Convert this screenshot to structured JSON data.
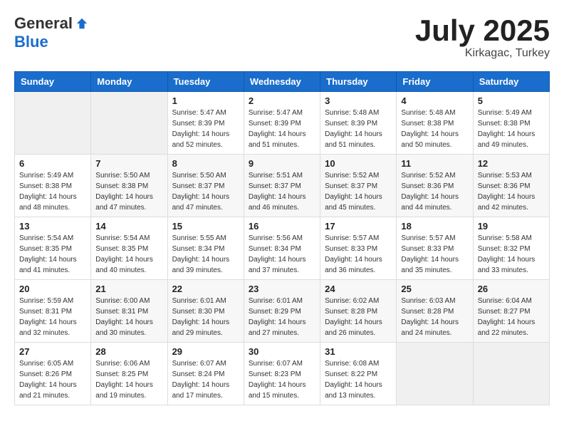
{
  "logo": {
    "general": "General",
    "blue": "Blue"
  },
  "header": {
    "month": "July 2025",
    "location": "Kirkagac, Turkey"
  },
  "weekdays": [
    "Sunday",
    "Monday",
    "Tuesday",
    "Wednesday",
    "Thursday",
    "Friday",
    "Saturday"
  ],
  "weeks": [
    [
      {
        "day": "",
        "sunrise": "",
        "sunset": "",
        "daylight": ""
      },
      {
        "day": "",
        "sunrise": "",
        "sunset": "",
        "daylight": ""
      },
      {
        "day": "1",
        "sunrise": "Sunrise: 5:47 AM",
        "sunset": "Sunset: 8:39 PM",
        "daylight": "Daylight: 14 hours and 52 minutes."
      },
      {
        "day": "2",
        "sunrise": "Sunrise: 5:47 AM",
        "sunset": "Sunset: 8:39 PM",
        "daylight": "Daylight: 14 hours and 51 minutes."
      },
      {
        "day": "3",
        "sunrise": "Sunrise: 5:48 AM",
        "sunset": "Sunset: 8:39 PM",
        "daylight": "Daylight: 14 hours and 51 minutes."
      },
      {
        "day": "4",
        "sunrise": "Sunrise: 5:48 AM",
        "sunset": "Sunset: 8:38 PM",
        "daylight": "Daylight: 14 hours and 50 minutes."
      },
      {
        "day": "5",
        "sunrise": "Sunrise: 5:49 AM",
        "sunset": "Sunset: 8:38 PM",
        "daylight": "Daylight: 14 hours and 49 minutes."
      }
    ],
    [
      {
        "day": "6",
        "sunrise": "Sunrise: 5:49 AM",
        "sunset": "Sunset: 8:38 PM",
        "daylight": "Daylight: 14 hours and 48 minutes."
      },
      {
        "day": "7",
        "sunrise": "Sunrise: 5:50 AM",
        "sunset": "Sunset: 8:38 PM",
        "daylight": "Daylight: 14 hours and 47 minutes."
      },
      {
        "day": "8",
        "sunrise": "Sunrise: 5:50 AM",
        "sunset": "Sunset: 8:37 PM",
        "daylight": "Daylight: 14 hours and 47 minutes."
      },
      {
        "day": "9",
        "sunrise": "Sunrise: 5:51 AM",
        "sunset": "Sunset: 8:37 PM",
        "daylight": "Daylight: 14 hours and 46 minutes."
      },
      {
        "day": "10",
        "sunrise": "Sunrise: 5:52 AM",
        "sunset": "Sunset: 8:37 PM",
        "daylight": "Daylight: 14 hours and 45 minutes."
      },
      {
        "day": "11",
        "sunrise": "Sunrise: 5:52 AM",
        "sunset": "Sunset: 8:36 PM",
        "daylight": "Daylight: 14 hours and 44 minutes."
      },
      {
        "day": "12",
        "sunrise": "Sunrise: 5:53 AM",
        "sunset": "Sunset: 8:36 PM",
        "daylight": "Daylight: 14 hours and 42 minutes."
      }
    ],
    [
      {
        "day": "13",
        "sunrise": "Sunrise: 5:54 AM",
        "sunset": "Sunset: 8:35 PM",
        "daylight": "Daylight: 14 hours and 41 minutes."
      },
      {
        "day": "14",
        "sunrise": "Sunrise: 5:54 AM",
        "sunset": "Sunset: 8:35 PM",
        "daylight": "Daylight: 14 hours and 40 minutes."
      },
      {
        "day": "15",
        "sunrise": "Sunrise: 5:55 AM",
        "sunset": "Sunset: 8:34 PM",
        "daylight": "Daylight: 14 hours and 39 minutes."
      },
      {
        "day": "16",
        "sunrise": "Sunrise: 5:56 AM",
        "sunset": "Sunset: 8:34 PM",
        "daylight": "Daylight: 14 hours and 37 minutes."
      },
      {
        "day": "17",
        "sunrise": "Sunrise: 5:57 AM",
        "sunset": "Sunset: 8:33 PM",
        "daylight": "Daylight: 14 hours and 36 minutes."
      },
      {
        "day": "18",
        "sunrise": "Sunrise: 5:57 AM",
        "sunset": "Sunset: 8:33 PM",
        "daylight": "Daylight: 14 hours and 35 minutes."
      },
      {
        "day": "19",
        "sunrise": "Sunrise: 5:58 AM",
        "sunset": "Sunset: 8:32 PM",
        "daylight": "Daylight: 14 hours and 33 minutes."
      }
    ],
    [
      {
        "day": "20",
        "sunrise": "Sunrise: 5:59 AM",
        "sunset": "Sunset: 8:31 PM",
        "daylight": "Daylight: 14 hours and 32 minutes."
      },
      {
        "day": "21",
        "sunrise": "Sunrise: 6:00 AM",
        "sunset": "Sunset: 8:31 PM",
        "daylight": "Daylight: 14 hours and 30 minutes."
      },
      {
        "day": "22",
        "sunrise": "Sunrise: 6:01 AM",
        "sunset": "Sunset: 8:30 PM",
        "daylight": "Daylight: 14 hours and 29 minutes."
      },
      {
        "day": "23",
        "sunrise": "Sunrise: 6:01 AM",
        "sunset": "Sunset: 8:29 PM",
        "daylight": "Daylight: 14 hours and 27 minutes."
      },
      {
        "day": "24",
        "sunrise": "Sunrise: 6:02 AM",
        "sunset": "Sunset: 8:28 PM",
        "daylight": "Daylight: 14 hours and 26 minutes."
      },
      {
        "day": "25",
        "sunrise": "Sunrise: 6:03 AM",
        "sunset": "Sunset: 8:28 PM",
        "daylight": "Daylight: 14 hours and 24 minutes."
      },
      {
        "day": "26",
        "sunrise": "Sunrise: 6:04 AM",
        "sunset": "Sunset: 8:27 PM",
        "daylight": "Daylight: 14 hours and 22 minutes."
      }
    ],
    [
      {
        "day": "27",
        "sunrise": "Sunrise: 6:05 AM",
        "sunset": "Sunset: 8:26 PM",
        "daylight": "Daylight: 14 hours and 21 minutes."
      },
      {
        "day": "28",
        "sunrise": "Sunrise: 6:06 AM",
        "sunset": "Sunset: 8:25 PM",
        "daylight": "Daylight: 14 hours and 19 minutes."
      },
      {
        "day": "29",
        "sunrise": "Sunrise: 6:07 AM",
        "sunset": "Sunset: 8:24 PM",
        "daylight": "Daylight: 14 hours and 17 minutes."
      },
      {
        "day": "30",
        "sunrise": "Sunrise: 6:07 AM",
        "sunset": "Sunset: 8:23 PM",
        "daylight": "Daylight: 14 hours and 15 minutes."
      },
      {
        "day": "31",
        "sunrise": "Sunrise: 6:08 AM",
        "sunset": "Sunset: 8:22 PM",
        "daylight": "Daylight: 14 hours and 13 minutes."
      },
      {
        "day": "",
        "sunrise": "",
        "sunset": "",
        "daylight": ""
      },
      {
        "day": "",
        "sunrise": "",
        "sunset": "",
        "daylight": ""
      }
    ]
  ]
}
